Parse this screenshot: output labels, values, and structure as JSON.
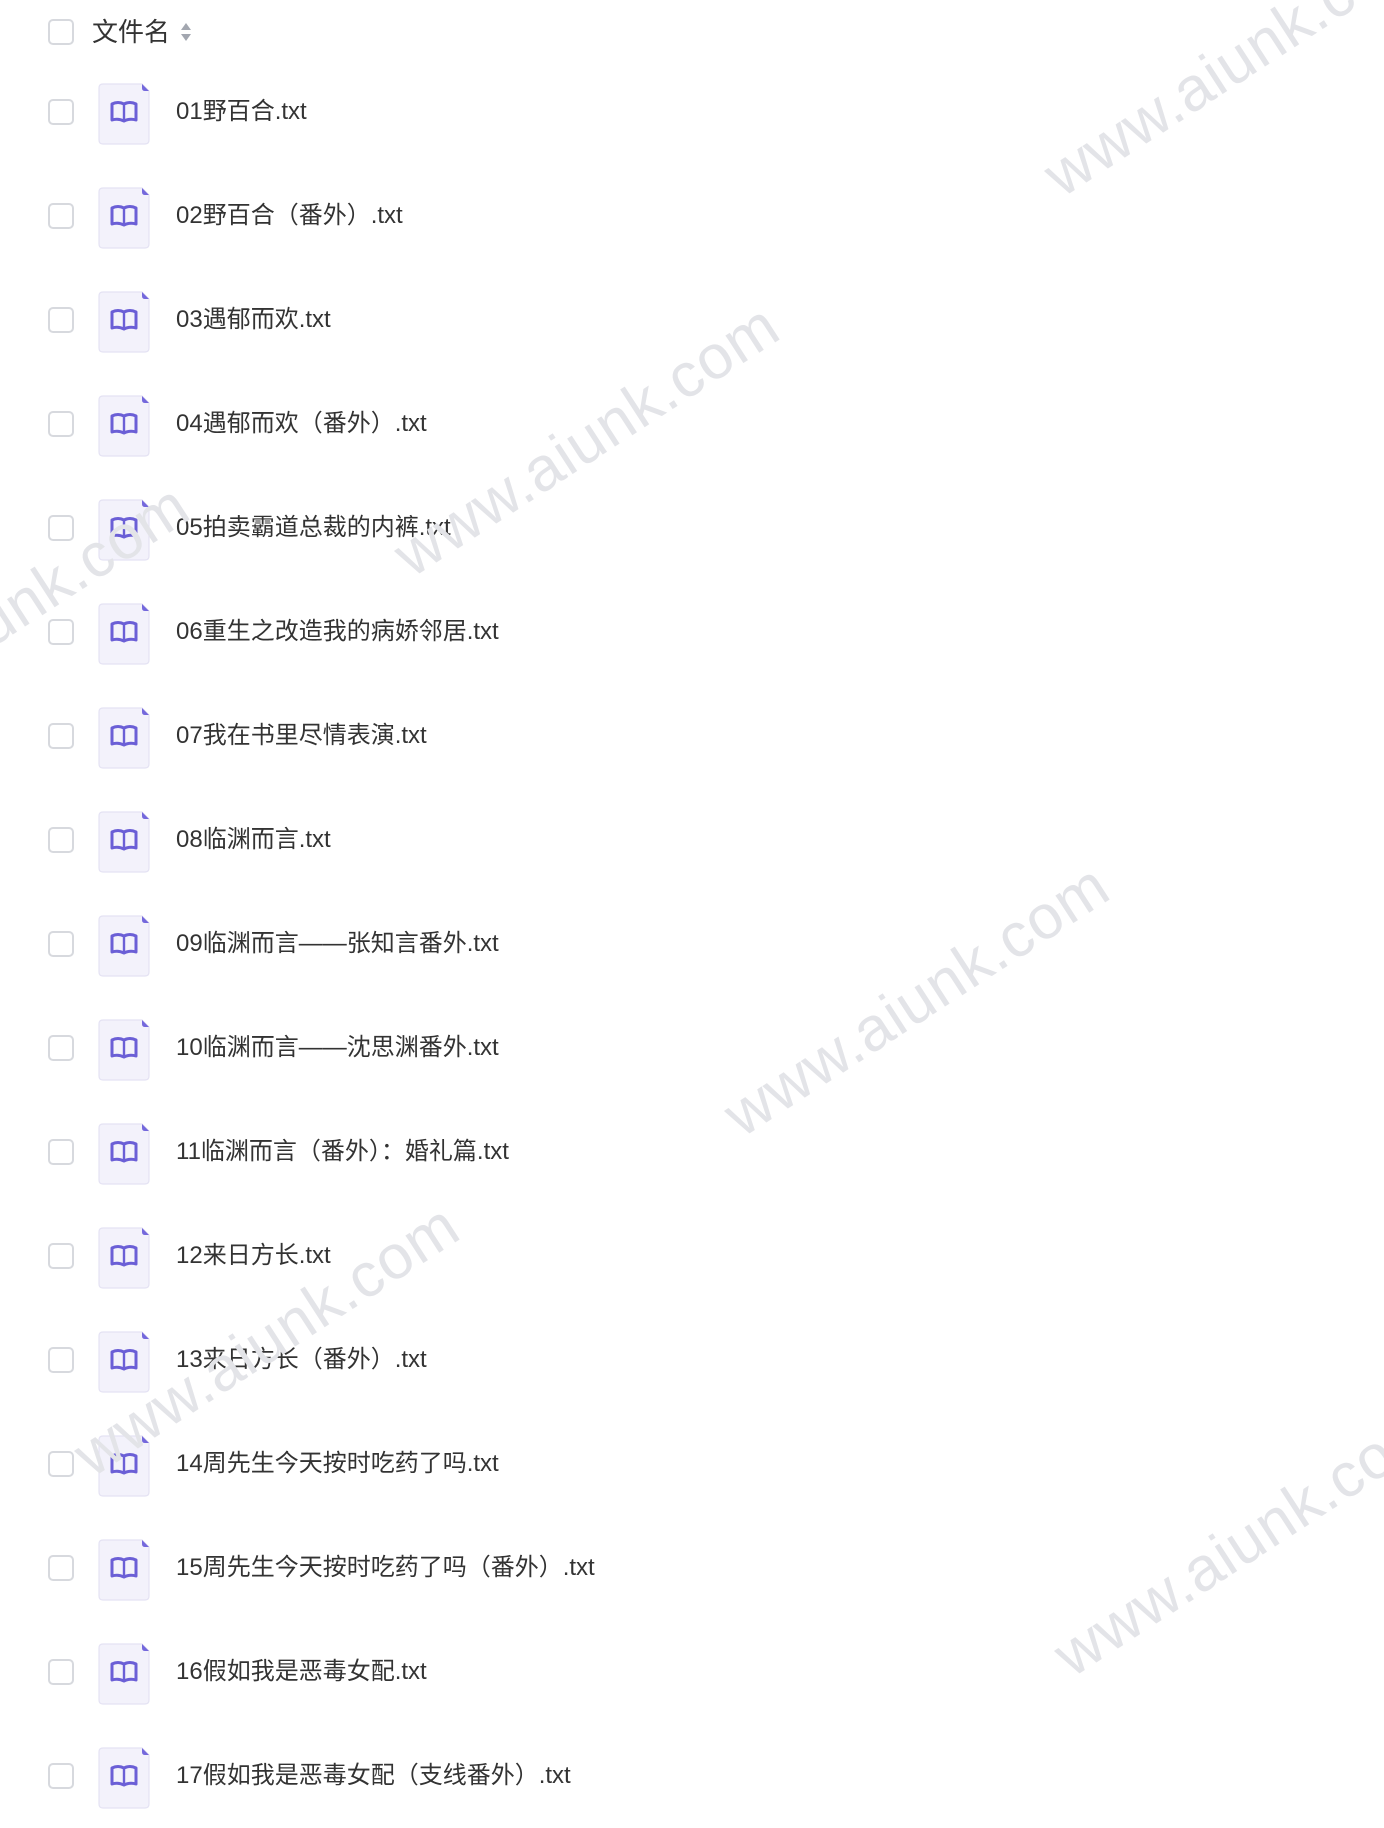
{
  "header": {
    "label": "文件名"
  },
  "colors": {
    "icon_bg": "#f3f2fb",
    "icon_accent": "#6b5fd6",
    "checkbox_border": "#d7d9de",
    "text": "#333333"
  },
  "files": [
    {
      "name": "01野百合.txt",
      "icon": "book-icon"
    },
    {
      "name": "02野百合（番外）.txt",
      "icon": "book-icon"
    },
    {
      "name": "03遇郁而欢.txt",
      "icon": "book-icon"
    },
    {
      "name": "04遇郁而欢（番外）.txt",
      "icon": "book-icon"
    },
    {
      "name": "05拍卖霸道总裁的内裤.txt",
      "icon": "book-icon"
    },
    {
      "name": "06重生之改造我的病娇邻居.txt",
      "icon": "book-icon"
    },
    {
      "name": "07我在书里尽情表演.txt",
      "icon": "book-icon"
    },
    {
      "name": "08临渊而言.txt",
      "icon": "book-icon"
    },
    {
      "name": "09临渊而言——张知言番外.txt",
      "icon": "book-icon"
    },
    {
      "name": "10临渊而言——沈思渊番外.txt",
      "icon": "book-icon"
    },
    {
      "name": "11临渊而言（番外）：婚礼篇.txt",
      "icon": "book-icon"
    },
    {
      "name": "12来日方长.txt",
      "icon": "book-icon"
    },
    {
      "name": "13来日方长（番外）.txt",
      "icon": "book-icon"
    },
    {
      "name": "14周先生今天按时吃药了吗.txt",
      "icon": "book-icon"
    },
    {
      "name": "15周先生今天按时吃药了吗（番外）.txt",
      "icon": "book-icon"
    },
    {
      "name": "16假如我是恶毒女配.txt",
      "icon": "book-icon"
    },
    {
      "name": "17假如我是恶毒女配（支线番外）.txt",
      "icon": "book-icon"
    }
  ],
  "watermark": "www.aiunk.com"
}
